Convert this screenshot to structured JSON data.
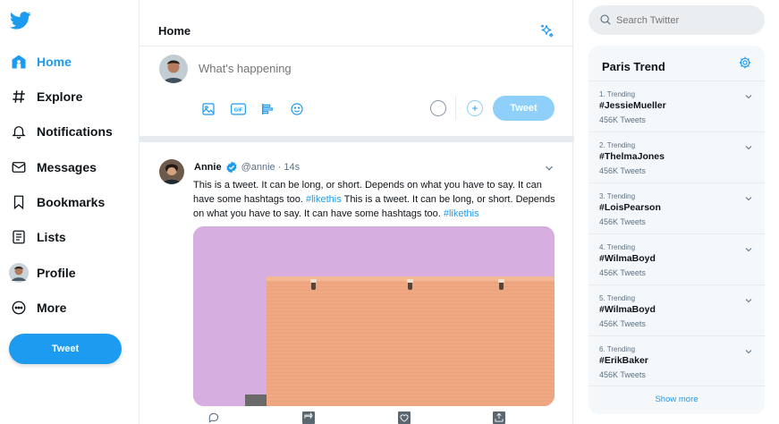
{
  "nav": {
    "items": [
      {
        "label": "Home",
        "icon": "home-icon"
      },
      {
        "label": "Explore",
        "icon": "hashtag-icon"
      },
      {
        "label": "Notifications",
        "icon": "bell-icon"
      },
      {
        "label": "Messages",
        "icon": "mail-icon"
      },
      {
        "label": "Bookmarks",
        "icon": "bookmark-icon"
      },
      {
        "label": "Lists",
        "icon": "list-icon"
      },
      {
        "label": "Profile",
        "icon": "avatar"
      },
      {
        "label": "More",
        "icon": "more-icon"
      }
    ],
    "tweet_label": "Tweet"
  },
  "header": {
    "title": "Home"
  },
  "compose": {
    "placeholder": "What's happening",
    "tweet_label": "Tweet"
  },
  "tweet": {
    "name": "Annie",
    "handle": "@annie",
    "separator": "·",
    "time": "14s",
    "text_1": "This is a tweet. It can be long, or short. Depends on what you have to say. It can have some hashtags too.",
    "hashtag_1": "#likethis",
    "text_2": "This is a tweet. It can be long, or short. Depends on what you have to say. It can have some hashtags too.",
    "hashtag_2": "#likethis"
  },
  "search": {
    "placeholder": "Search Twitter"
  },
  "trends": {
    "title": "Paris Trend",
    "items": [
      {
        "rank": "1. Trending",
        "tag": "#JessieMueller",
        "count": "456K Tweets"
      },
      {
        "rank": "2. Trending",
        "tag": "#ThelmaJones",
        "count": "456K Tweets"
      },
      {
        "rank": "3. Trending",
        "tag": "#LoisPearson",
        "count": "456K Tweets"
      },
      {
        "rank": "4. Trending",
        "tag": "#WilmaBoyd",
        "count": "456K Tweets"
      },
      {
        "rank": "5. Trending",
        "tag": "#WilmaBoyd",
        "count": "456K Tweets"
      },
      {
        "rank": "6. Trending",
        "tag": "#ErikBaker",
        "count": "456K Tweets"
      }
    ],
    "show_more": "Show more"
  },
  "colors": {
    "accent": "#1d9bf0",
    "accent_light": "#8ed0f9",
    "text": "#0f1419",
    "muted": "#5b7083"
  }
}
